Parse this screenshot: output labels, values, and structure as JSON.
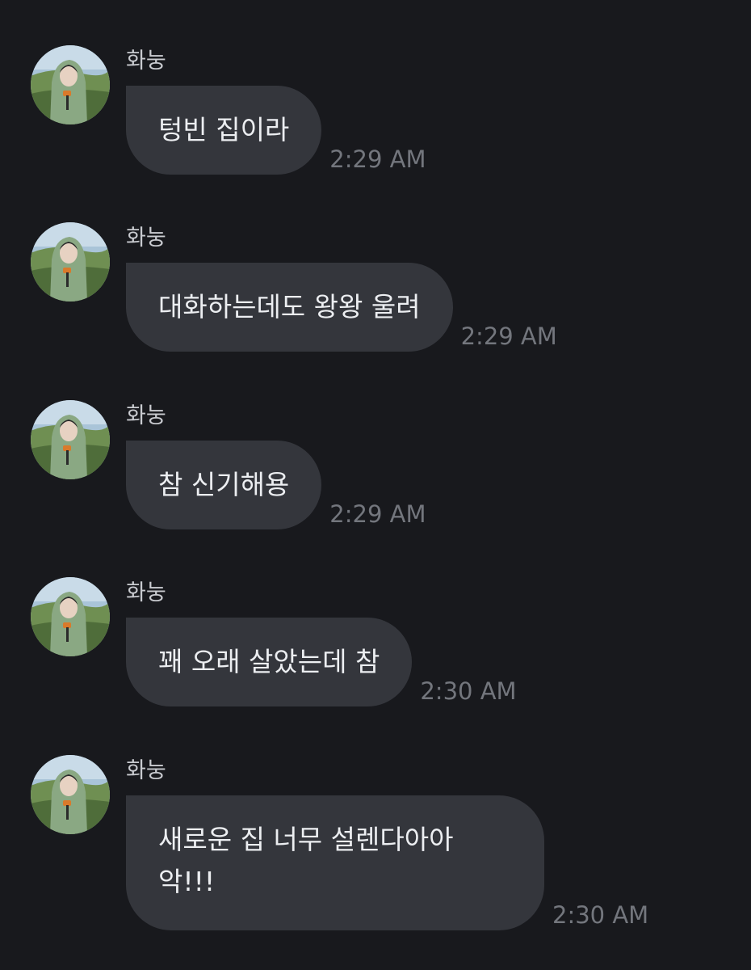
{
  "messages": [
    {
      "sender": "화눙",
      "text": "텅빈 집이라",
      "time": "2:29 AM"
    },
    {
      "sender": "화눙",
      "text": "대화하는데도 왕왕 울려",
      "time": "2:29 AM"
    },
    {
      "sender": "화눙",
      "text": "참 신기해용",
      "time": "2:29 AM"
    },
    {
      "sender": "화눙",
      "text": "꽤 오래 살았는데 참",
      "time": "2:30 AM"
    },
    {
      "sender": "화눙",
      "text": "새로운 집 너무 설렌다아아 악!!!",
      "time": "2:30 AM"
    }
  ],
  "colors": {
    "background": "#18191d",
    "bubble": "#34363c",
    "bubble_text": "#eceef1",
    "sender_text": "#c9cbd0",
    "time_text": "#73767d"
  },
  "icons": {
    "avatar": "profile-photo-hooded-person-meadow"
  }
}
